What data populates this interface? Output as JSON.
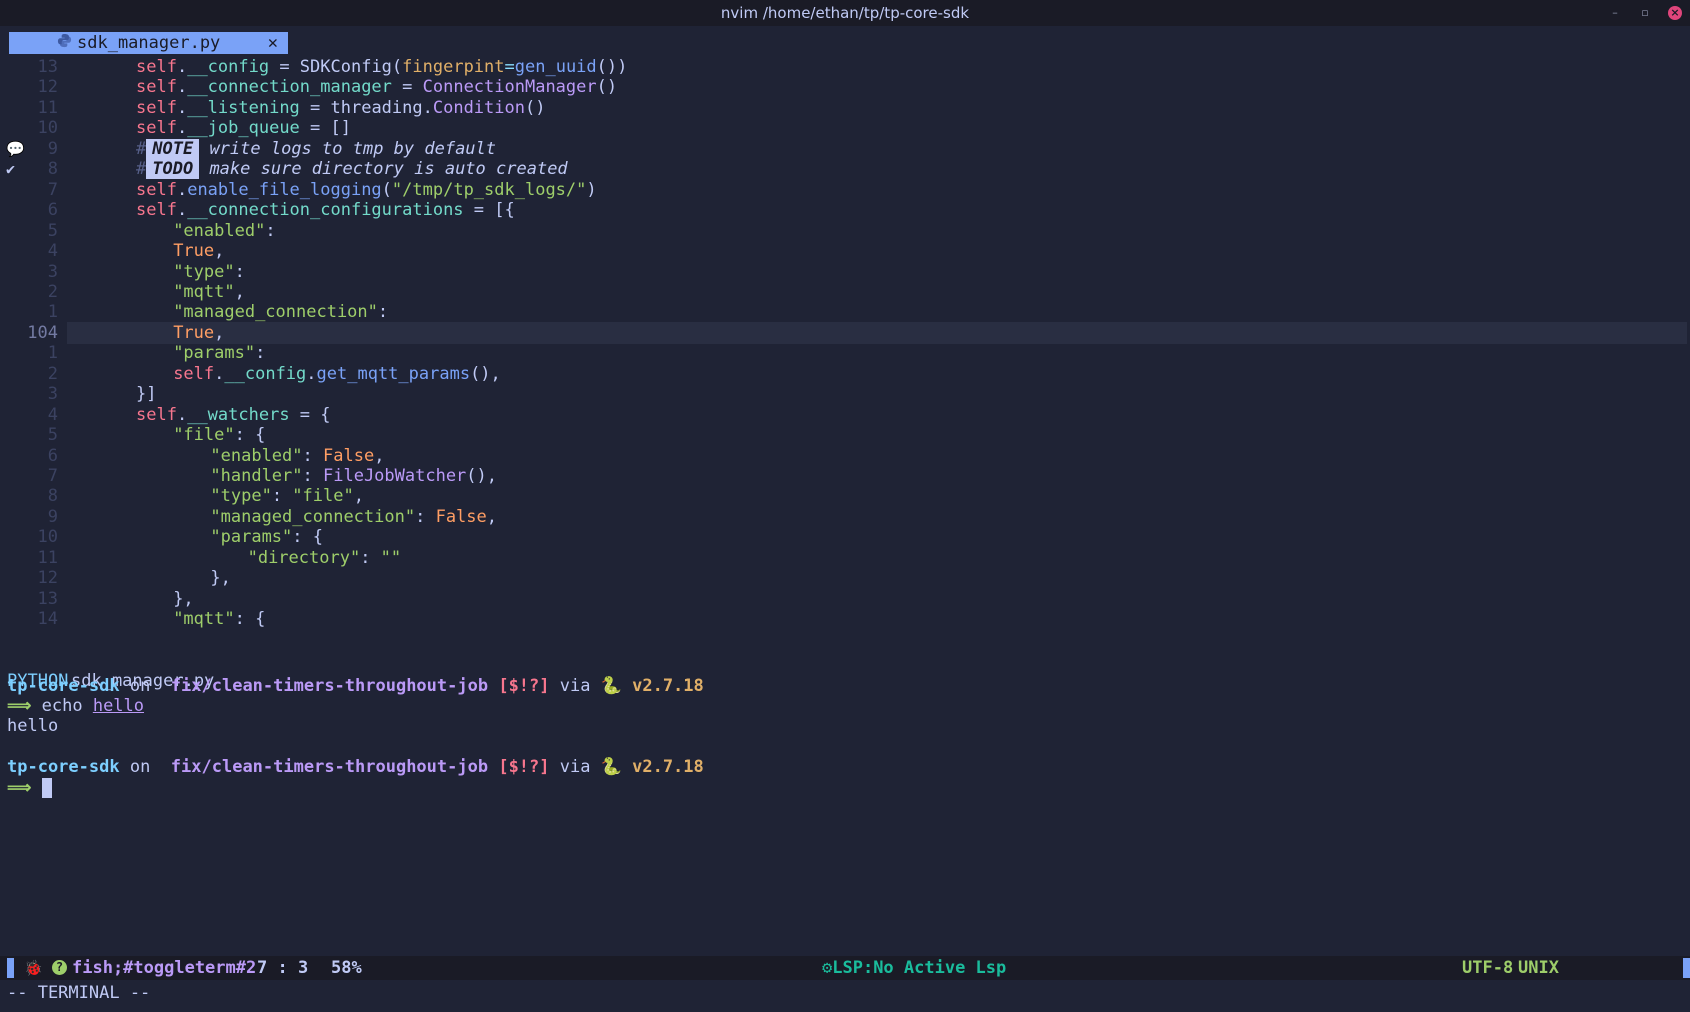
{
  "window": {
    "title": "nvim /home/ethan/tp/tp-core-sdk",
    "minimize": "–",
    "maximize": "▫",
    "close": "×"
  },
  "tab": {
    "name": "sdk_manager.py",
    "close": "✕",
    "icon": "python-icon"
  },
  "lines": [
    {
      "n": "13",
      "segs": [
        [
          "kw",
          "self"
        ],
        [
          "",
          "."
        ],
        [
          "at",
          "__config"
        ],
        [
          "",
          " = SDKConfig("
        ],
        [
          "par",
          "fingerpint"
        ],
        [
          "op",
          "="
        ],
        [
          "fn",
          "gen_uuid"
        ],
        [
          "",
          "())"
        ]
      ]
    },
    {
      "n": "12",
      "segs": [
        [
          "kw",
          "self"
        ],
        [
          "",
          "."
        ],
        [
          "at",
          "__connection_manager"
        ],
        [
          "",
          " = "
        ],
        [
          "cls",
          "ConnectionManager"
        ],
        [
          "",
          "()"
        ]
      ]
    },
    {
      "n": "11",
      "segs": [
        [
          "kw",
          "self"
        ],
        [
          "",
          "."
        ],
        [
          "at",
          "__listening"
        ],
        [
          "",
          " = threading."
        ],
        [
          "cls",
          "Condition"
        ],
        [
          "",
          "()"
        ]
      ]
    },
    {
      "n": "10",
      "segs": [
        [
          "kw",
          "self"
        ],
        [
          "",
          "."
        ],
        [
          "at",
          "__job_queue"
        ],
        [
          "",
          " = []"
        ]
      ]
    },
    {
      "n": "9",
      "sign": "💬",
      "segs": [
        [
          "cm",
          "#"
        ],
        [
          "tag",
          "NOTE"
        ],
        [
          "cmtxt",
          " write logs to tmp by default"
        ]
      ]
    },
    {
      "n": "8",
      "sign": "✔",
      "segs": [
        [
          "cm",
          "#"
        ],
        [
          "tag",
          "TODO"
        ],
        [
          "cmtxt",
          " make sure directory is auto created"
        ]
      ]
    },
    {
      "n": "7",
      "segs": [
        [
          "kw",
          "self"
        ],
        [
          "",
          "."
        ],
        [
          "fn",
          "enable_file_logging"
        ],
        [
          "",
          "("
        ],
        [
          "str",
          "\"/tmp/tp_sdk_logs/\""
        ],
        [
          "",
          ")"
        ]
      ]
    },
    {
      "n": "6",
      "segs": [
        [
          "kw",
          "self"
        ],
        [
          "",
          "."
        ],
        [
          "at",
          "__connection_configurations"
        ],
        [
          "",
          " = [{"
        ]
      ]
    },
    {
      "n": "5",
      "indent": "    ",
      "segs": [
        [
          "str",
          "\"enabled\""
        ],
        [
          "",
          ":"
        ]
      ]
    },
    {
      "n": "4",
      "indent": "    ",
      "segs": [
        [
          "num",
          "True"
        ],
        [
          "",
          ","
        ]
      ]
    },
    {
      "n": "3",
      "indent": "    ",
      "segs": [
        [
          "str",
          "\"type\""
        ],
        [
          "",
          ":"
        ]
      ]
    },
    {
      "n": "2",
      "indent": "    ",
      "segs": [
        [
          "str",
          "\"mqtt\""
        ],
        [
          "",
          ","
        ]
      ]
    },
    {
      "n": "1",
      "indent": "    ",
      "segs": [
        [
          "str",
          "\"managed_connection\""
        ],
        [
          "",
          ":"
        ]
      ]
    },
    {
      "n": "104",
      "current": true,
      "indent": "    ",
      "segs": [
        [
          "num",
          "True"
        ],
        [
          "",
          ","
        ]
      ]
    },
    {
      "n": "1",
      "indent": "    ",
      "segs": [
        [
          "str",
          "\"params\""
        ],
        [
          "",
          ":"
        ]
      ]
    },
    {
      "n": "2",
      "indent": "    ",
      "segs": [
        [
          "kw",
          "self"
        ],
        [
          "",
          "."
        ],
        [
          "at",
          "__config"
        ],
        [
          "",
          "."
        ],
        [
          "fn",
          "get_mqtt_params"
        ],
        [
          "",
          "(),"
        ]
      ]
    },
    {
      "n": "3",
      "segs": [
        [
          "",
          "}]"
        ]
      ]
    },
    {
      "n": "4",
      "segs": [
        [
          "kw",
          "self"
        ],
        [
          "",
          "."
        ],
        [
          "at",
          "__watchers"
        ],
        [
          "",
          " = {"
        ]
      ]
    },
    {
      "n": "5",
      "indent": "    ",
      "segs": [
        [
          "str",
          "\"file\""
        ],
        [
          "",
          ": {"
        ]
      ]
    },
    {
      "n": "6",
      "indent": "        ",
      "segs": [
        [
          "str",
          "\"enabled\""
        ],
        [
          "",
          ": "
        ],
        [
          "num",
          "False"
        ],
        [
          "",
          ","
        ]
      ]
    },
    {
      "n": "7",
      "indent": "        ",
      "segs": [
        [
          "str",
          "\"handler\""
        ],
        [
          "",
          ": "
        ],
        [
          "cls",
          "FileJobWatcher"
        ],
        [
          "",
          "(),"
        ]
      ]
    },
    {
      "n": "8",
      "indent": "        ",
      "segs": [
        [
          "str",
          "\"type\""
        ],
        [
          "",
          ": "
        ],
        [
          "str",
          "\"file\""
        ],
        [
          "",
          ","
        ]
      ]
    },
    {
      "n": "9",
      "indent": "        ",
      "segs": [
        [
          "str",
          "\"managed_connection\""
        ],
        [
          "",
          ": "
        ],
        [
          "num",
          "False"
        ],
        [
          "",
          ","
        ]
      ]
    },
    {
      "n": "10",
      "indent": "        ",
      "segs": [
        [
          "str",
          "\"params\""
        ],
        [
          "",
          ": {"
        ]
      ]
    },
    {
      "n": "11",
      "indent": "            ",
      "segs": [
        [
          "str",
          "\"directory\""
        ],
        [
          "",
          ": "
        ],
        [
          "str",
          "\"\""
        ]
      ]
    },
    {
      "n": "12",
      "indent": "        ",
      "segs": [
        [
          "",
          "},"
        ]
      ]
    },
    {
      "n": "13",
      "indent": "    ",
      "segs": [
        [
          "",
          "},"
        ]
      ]
    },
    {
      "n": "14",
      "indent": "    ",
      "segs": [
        [
          "str",
          "\"mqtt\""
        ],
        [
          "",
          ": {"
        ]
      ]
    }
  ],
  "file_status": {
    "filetype": "PYTHON",
    "filename": "sdk_manager.py"
  },
  "terminal": {
    "prompt1": {
      "dir": "tp-core-sdk",
      "on": " on ",
      "branch_icon": "",
      "branch": "fix/clean-timers-throughout-job",
      "flags": "[$!?]",
      "via": " via ",
      "snake": "🐍",
      "version": "v2.7.18"
    },
    "arrow": "⟹",
    "command": "echo",
    "argument": "hello",
    "output": "hello"
  },
  "statusbar": {
    "bug_icon": "🐞",
    "help_icon": "?",
    "buffer": "fish;#toggleterm#2",
    "position": "7 : 3",
    "percent": "58%",
    "lsp": "LSP:No Active Lsp",
    "encoding": "UTF-8",
    "format": "UNIX"
  },
  "mode": "-- TERMINAL --"
}
